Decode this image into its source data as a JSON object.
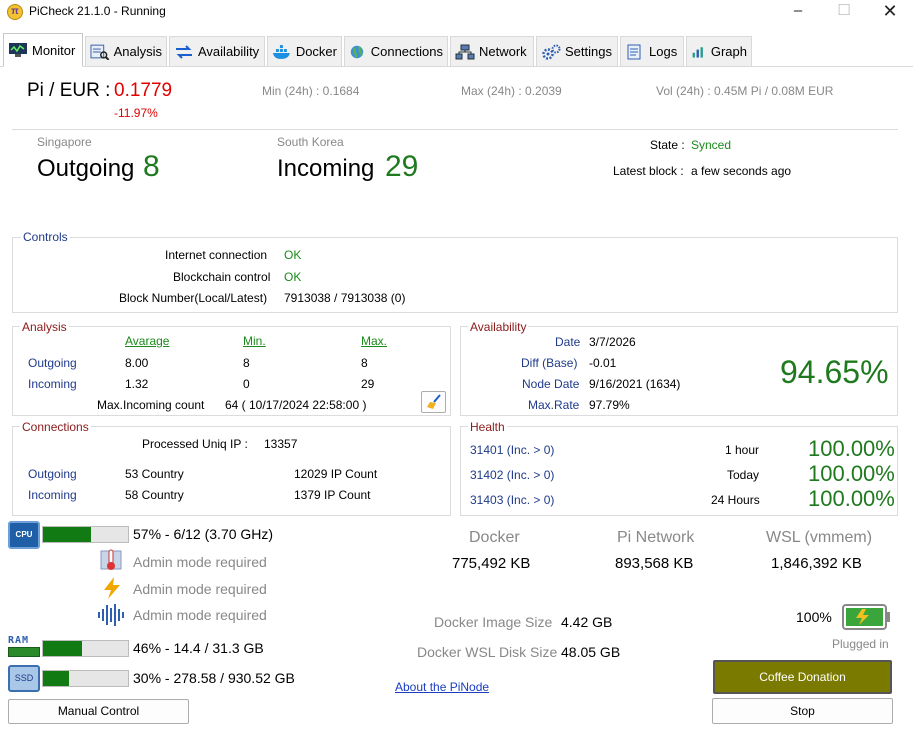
{
  "window": {
    "title": "PiCheck 21.1.0 - Running"
  },
  "tabs": [
    {
      "label": "Monitor",
      "icon": "monitor-icon"
    },
    {
      "label": "Analysis",
      "icon": "analysis-icon"
    },
    {
      "label": "Availability",
      "icon": "availability-icon"
    },
    {
      "label": "Docker",
      "icon": "docker-icon"
    },
    {
      "label": "Connections",
      "icon": "globe-icon"
    },
    {
      "label": "Network",
      "icon": "network-icon"
    },
    {
      "label": "Settings",
      "icon": "gears-icon"
    },
    {
      "label": "Logs",
      "icon": "logs-icon"
    },
    {
      "label": "Graph",
      "icon": "graph-icon"
    }
  ],
  "price": {
    "pair": "Pi / EUR :",
    "value": "0.1779",
    "change": "-11.97%",
    "min": "Min (24h) : 0.1684",
    "max": "Max (24h) : 0.2039",
    "vol": "Vol (24h) : 0.45M Pi / 0.08M EUR"
  },
  "peers": {
    "outgoing_region": "Singapore",
    "outgoing_label": "Outgoing",
    "outgoing_value": "8",
    "incoming_region": "South Korea",
    "incoming_label": "Incoming",
    "incoming_value": "29"
  },
  "state": {
    "state_label": "State :",
    "state_value": "Synced",
    "block_label": "Latest block :",
    "block_value": "a few seconds ago"
  },
  "controls": {
    "title": "Controls",
    "internet_label": "Internet connection",
    "internet_value": "OK",
    "blockchain_label": "Blockchain control",
    "blockchain_value": "OK",
    "blocknum_label": "Block Number(Local/Latest)",
    "blocknum_value": "7913038 / 7913038  (0)"
  },
  "analysis": {
    "title": "Analysis",
    "headers": [
      "Avarage",
      "Min.",
      "Max."
    ],
    "rows": [
      {
        "label": "Outgoing",
        "avg": "8.00",
        "min": "8",
        "max": "8"
      },
      {
        "label": "Incoming",
        "avg": "1.32",
        "min": "0",
        "max": "29"
      }
    ],
    "max_incoming_label": "Max.Incoming count",
    "max_incoming_value": "64  ( 10/17/2024 22:58:00 )"
  },
  "availability": {
    "title": "Availability",
    "date_label": "Date",
    "date_value": "3/7/2026",
    "diff_label": "Diff (Base)",
    "diff_value": "-0.01",
    "node_label": "Node Date",
    "node_value": "9/16/2021 (1634)",
    "rate_label": "Max.Rate",
    "rate_value": "97.79%",
    "percent": "94.65%"
  },
  "connections": {
    "title": "Connections",
    "uniq_label": "Processed Uniq IP :",
    "uniq_value": "13357",
    "rows": [
      {
        "label": "Outgoing",
        "country": "53 Country",
        "ip": "12029 IP Count"
      },
      {
        "label": "Incoming",
        "country": "58 Country",
        "ip": "1379 IP Count"
      }
    ]
  },
  "health": {
    "title": "Health",
    "rows": [
      {
        "port": "31401 (Inc. > 0)",
        "period": "1 hour",
        "value": "100.00%"
      },
      {
        "port": "31402 (Inc. > 0)",
        "period": "Today",
        "value": "100.00%"
      },
      {
        "port": "31403 (Inc. > 0)",
        "period": "24 Hours",
        "value": "100.00%"
      }
    ]
  },
  "system": {
    "cpu_label": "CPU",
    "cpu_fraction": 0.57,
    "cpu_text": "57% - 6/12 (3.70 GHz)",
    "admin1": "Admin mode required",
    "admin2": "Admin mode required",
    "admin3": "Admin mode required",
    "ram_label": "RAM",
    "ram_fraction": 0.46,
    "ram_text": "46% - 14.4 / 31.3 GB",
    "ssd_label": "SSD",
    "ssd_fraction": 0.3,
    "ssd_text": "30% - 278.58 / 930.52 GB"
  },
  "memory": {
    "docker_label": "Docker",
    "docker_value": "775,492 KB",
    "pinet_label": "Pi Network",
    "pinet_value": "893,568 KB",
    "wsl_label": "WSL (vmmem)",
    "wsl_value": "1,846,392 KB",
    "image_label": "Docker Image Size",
    "image_value": "4.42 GB",
    "disk_label": "Docker WSL Disk Size",
    "disk_value": "48.05 GB"
  },
  "battery": {
    "percent": "100%",
    "status": "Plugged in"
  },
  "buttons": {
    "manual": "Manual Control",
    "about": "About the PiNode",
    "coffee": "Coffee Donation",
    "stop": "Stop"
  },
  "colors": {
    "accent_green": "#1f7a1f",
    "coffee_bg": "#7a7a00",
    "price_red": "#e00000"
  }
}
